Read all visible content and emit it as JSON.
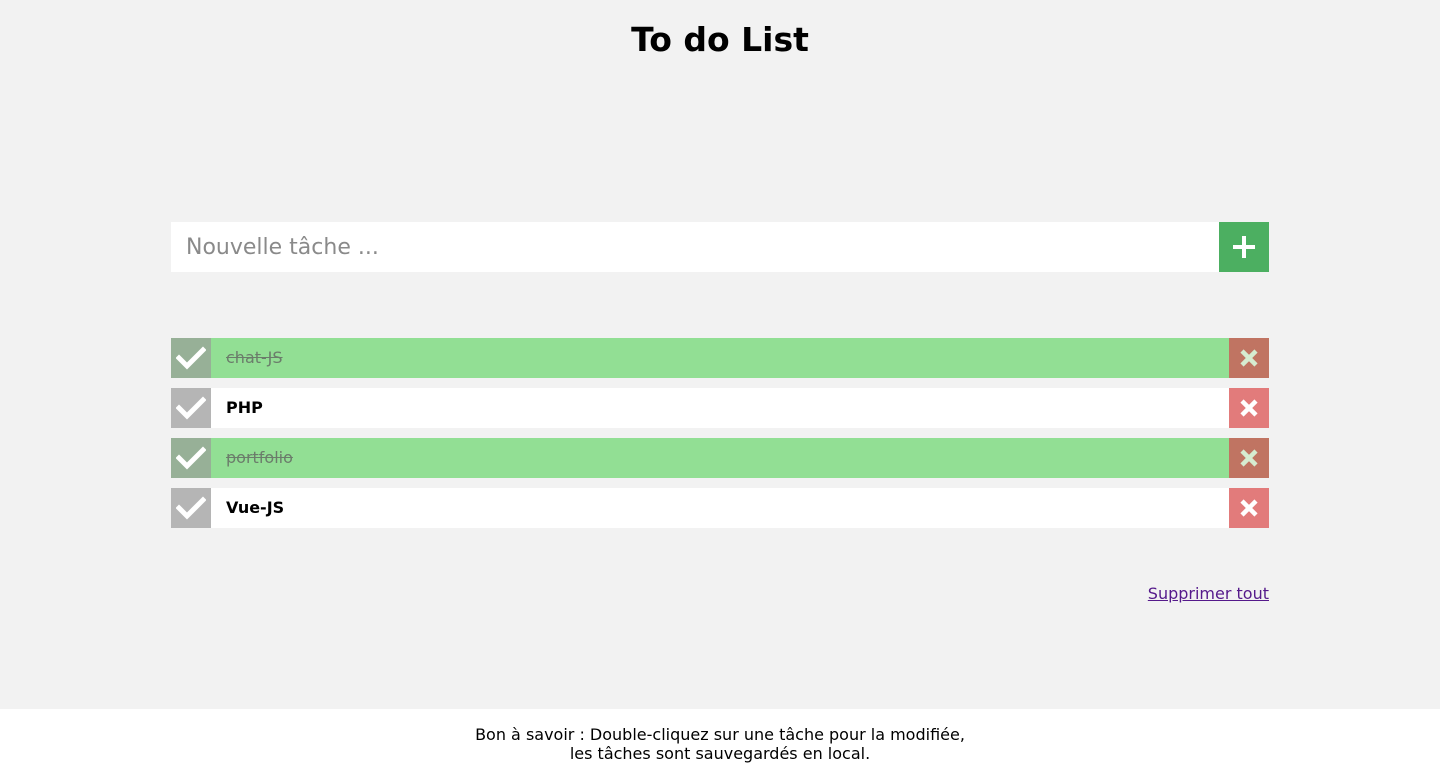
{
  "header": {
    "title": "To do List"
  },
  "new_task": {
    "placeholder": "Nouvelle tâche ...",
    "value": "",
    "add_icon": "plus-icon"
  },
  "tasks": [
    {
      "label": "chat-JS",
      "done": true
    },
    {
      "label": "PHP",
      "done": false
    },
    {
      "label": "portfolio",
      "done": true
    },
    {
      "label": "Vue-JS",
      "done": false
    }
  ],
  "actions": {
    "delete_all_label": "Supprimer tout"
  },
  "footer": {
    "line1": "Bon à savoir : Double-cliquez sur une tâche pour la modifiée,",
    "line2": "les tâches sont sauvegardés en local."
  },
  "colors": {
    "background": "#f2f2f2",
    "add_button": "#4caf61",
    "done_row": "#92df94",
    "check_done": "#97b097",
    "check_pending": "#b5b5b5",
    "delete_done": "#c07462",
    "delete_pending": "#e27b7b",
    "link": "#551a8b"
  }
}
